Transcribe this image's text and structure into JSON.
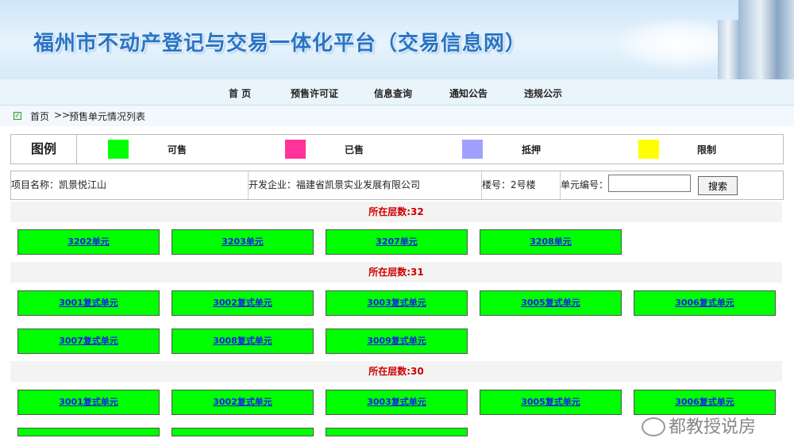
{
  "header": {
    "site_title": "福州市不动产登记与交易一体化平台（交易信息网）"
  },
  "nav": {
    "items": [
      {
        "label": "首 页"
      },
      {
        "label": "预售许可证"
      },
      {
        "label": "信息查询"
      },
      {
        "label": "通知公告"
      },
      {
        "label": "违规公示"
      }
    ]
  },
  "breadcrumb": {
    "home": "首页",
    "sep": ">>",
    "current": "预售单元情况列表"
  },
  "legend": {
    "title": "图例",
    "items": [
      {
        "label": "可售",
        "color": "#00ff00"
      },
      {
        "label": "已售",
        "color": "#ff3399"
      },
      {
        "label": "抵押",
        "color": "#a0a0ff"
      },
      {
        "label": "限制",
        "color": "#ffff00"
      }
    ]
  },
  "project": {
    "name": "项目名称：凯景悦江山",
    "developer": "开发企业：福建省凯景实业发展有限公司",
    "building": "楼号：2号楼",
    "unit_label": "单元编号：",
    "unit_value": "",
    "search_label": "搜索"
  },
  "floors": [
    {
      "label": "所在层数:32",
      "units": [
        "3202单元",
        "3203单元",
        "3207单元",
        "3208单元"
      ]
    },
    {
      "label": "所在层数:31",
      "units": [
        "3001复式单元",
        "3002复式单元",
        "3003复式单元",
        "3005复式单元",
        "3006复式单元",
        "3007复式单元",
        "3008复式单元",
        "3009复式单元"
      ]
    },
    {
      "label": "所在层数:30",
      "units": [
        "3001复式单元",
        "3002复式单元",
        "3003复式单元",
        "3005复式单元",
        "3006复式单元"
      ]
    }
  ],
  "watermark": "都教授说房"
}
